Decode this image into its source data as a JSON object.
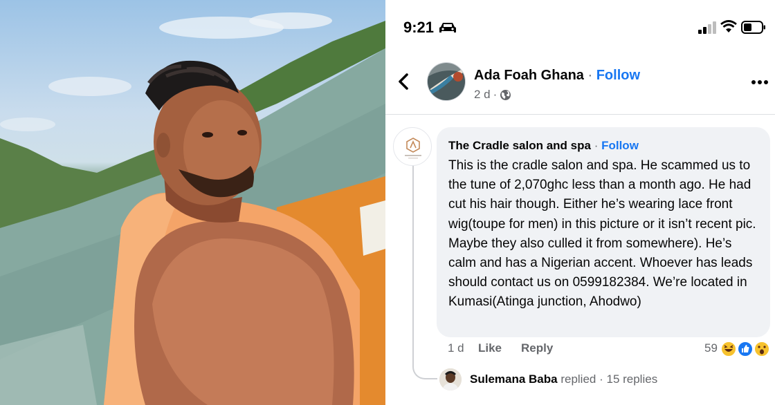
{
  "status_bar": {
    "time": "9:21"
  },
  "post": {
    "page_name": "Ada Foah Ghana",
    "separator": "·",
    "follow_label": "Follow",
    "age": "2 d",
    "meta_separator": "·"
  },
  "comment": {
    "author": "The Cradle salon and spa",
    "separator": "·",
    "follow_label": "Follow",
    "text": "This is the cradle salon and spa. He scammed us to the tune of 2,070ghc less than a month ago. He had cut his hair though. Either he’s wearing lace front wig(toupe for men) in this picture or it isn’t recent pic. Maybe they also culled it from somewhere). He’s calm  and has a Nigerian accent. Whoever has leads should contact us on 0599182384. We’re located in Kumasi(Atinga junction, Ahodwo)",
    "time": "1 d",
    "like_label": "Like",
    "reply_label": "Reply",
    "reaction_count": "59",
    "reaction_icons": [
      "haha-icon",
      "like-icon",
      "wow-icon"
    ]
  },
  "replies": {
    "name": "Sulemana Baba",
    "action": " replied",
    "separator": " · ",
    "count_label": "15 replies"
  },
  "colors": {
    "link_blue": "#1877f2",
    "bubble_bg": "#f0f2f5",
    "muted_text": "#65676b"
  }
}
